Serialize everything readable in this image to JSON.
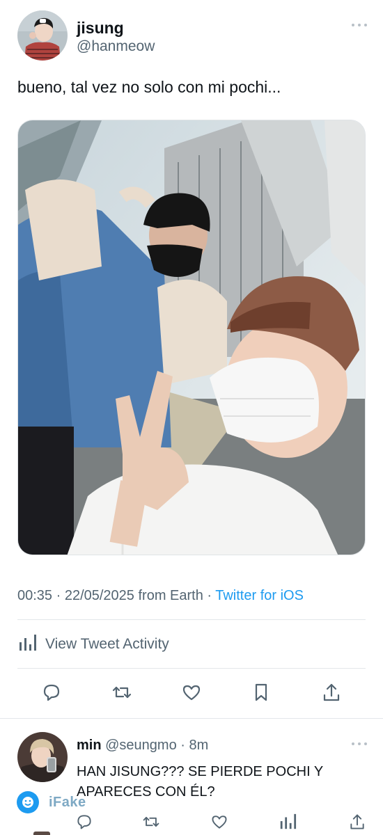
{
  "tweet": {
    "author": {
      "name": "jisung",
      "handle": "@hanmeow"
    },
    "text": "bueno, tal vez no solo con mi pochi...",
    "timestamp": "00:35 · 22/05/2025 from Earth · ",
    "source": "Twitter for iOS",
    "activity_label": "View Tweet Activity",
    "actions": [
      "reply-icon",
      "retweet-icon",
      "like-icon",
      "bookmark-icon",
      "share-icon"
    ]
  },
  "reply": {
    "name": "min",
    "handle": "@seungmo",
    "separator": " · ",
    "time": "8m",
    "text": "HAN JISUNG??? SE PIERDE POCHI Y APARECES CON ÉL?",
    "actions": [
      "reply-icon",
      "retweet-icon",
      "like-icon",
      "activity-icon",
      "share-icon"
    ]
  },
  "watermark": {
    "label": "iFake"
  },
  "colors": {
    "text": "#0f1419",
    "secondary": "#536471",
    "link": "#1d9bf0",
    "divider": "#e3e7ea"
  }
}
